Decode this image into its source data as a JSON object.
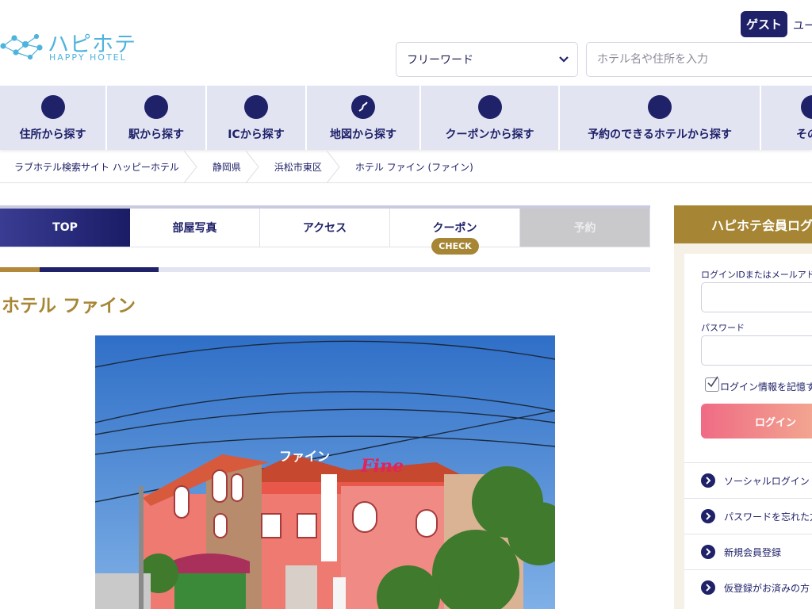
{
  "header": {
    "logo_text": "ハピホテ",
    "logo_sub": "HAPPY HOTEL",
    "guest_label": "ゲスト",
    "user_text": "ユー"
  },
  "search": {
    "select_value": "フリーワード",
    "input_placeholder": "ホテル名や住所を入力"
  },
  "nav": {
    "items": [
      {
        "label": "住所から探す",
        "icon": "location-icon"
      },
      {
        "label": "駅から探す",
        "icon": "train-icon"
      },
      {
        "label": "ICから探す",
        "icon": "highway-icon"
      },
      {
        "label": "地図から探す",
        "icon": "map-icon"
      },
      {
        "label": "クーポンから探す",
        "icon": "coupon-icon"
      },
      {
        "label": "予約のできるホテルから探す",
        "icon": "calendar-icon"
      },
      {
        "label": "その他",
        "icon": "more-icon"
      }
    ]
  },
  "breadcrumb": [
    "ラブホテル検索サイト ハッピーホテル",
    "静岡県",
    "浜松市東区",
    "ホテル ファイン (ファイン)"
  ],
  "tabs": [
    {
      "label": "TOP"
    },
    {
      "label": "部屋写真"
    },
    {
      "label": "アクセス"
    },
    {
      "label": "クーポン"
    },
    {
      "label": "予約"
    }
  ],
  "check_badge": "CHECK",
  "hotel": {
    "title": "ホテル ファイン"
  },
  "login": {
    "title": "ハピホテ会員ログ",
    "id_label": "ログインIDまたはメールアドレ",
    "password_label": "パスワード",
    "remember_label": "ログイン情報を記憶す",
    "submit_label": "ログイン",
    "links": [
      "ソーシャルログイン",
      "パスワードを忘れた方",
      "新規会員登録",
      "仮登録がお済みの方"
    ]
  },
  "colors": {
    "navy": "#1f2169",
    "gold": "#a68634",
    "nav_bg": "#e3e4f2"
  }
}
